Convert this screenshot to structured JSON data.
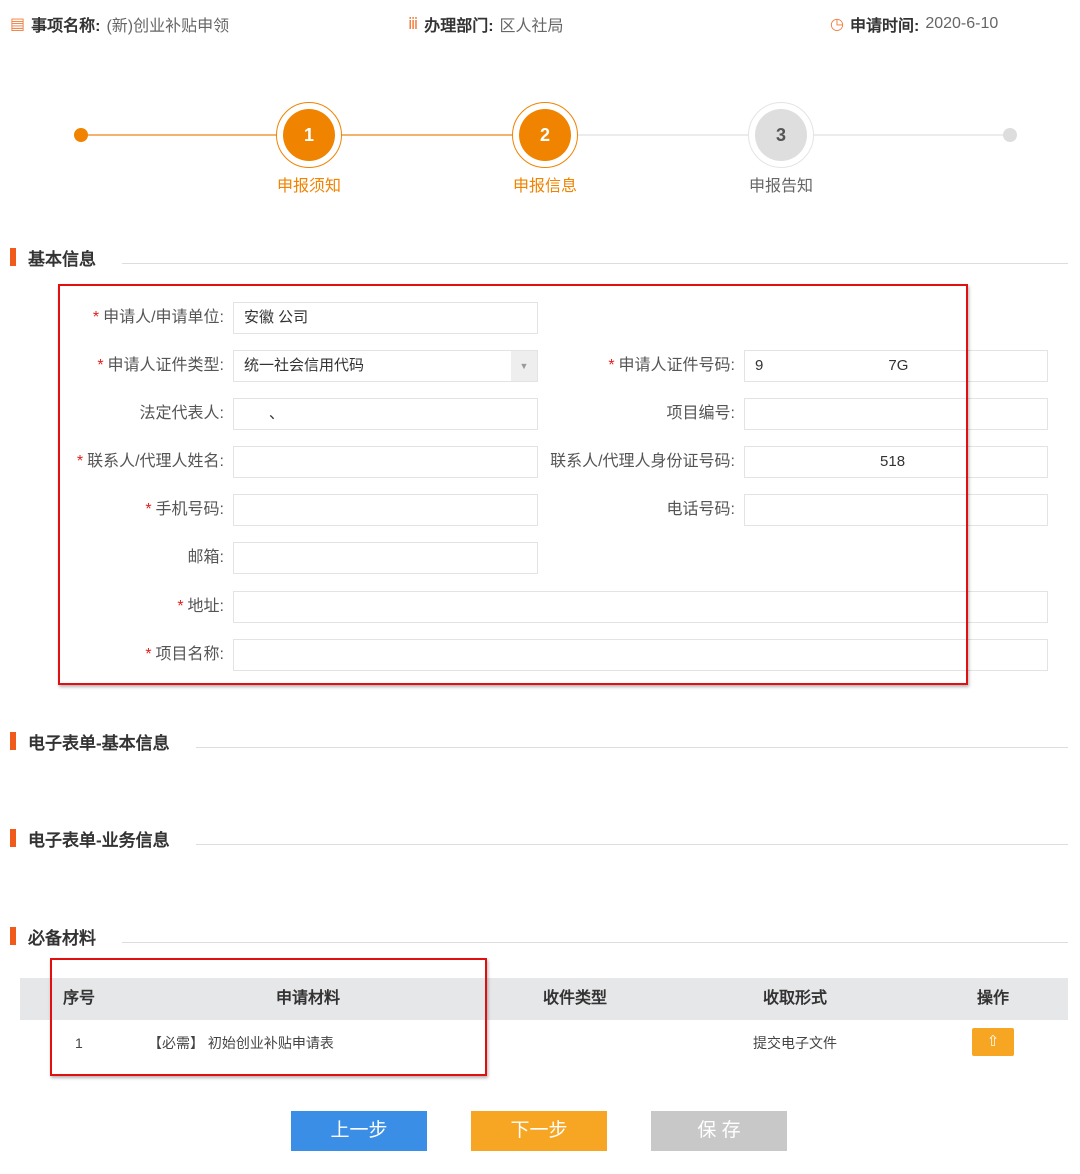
{
  "header": {
    "item_label": "事项名称:",
    "item_value": "(新)创业补贴申领",
    "dept_label": "办理部门:",
    "dept_value": "区人社局",
    "time_label": "申请时间:",
    "time_value": "2020-6-10"
  },
  "steps": [
    {
      "num": "1",
      "label": "申报须知",
      "state": "done"
    },
    {
      "num": "2",
      "label": "申报信息",
      "state": "active"
    },
    {
      "num": "3",
      "label": "申报告知",
      "state": "pending"
    }
  ],
  "sections": {
    "basic": "基本信息",
    "eform_basic": "电子表单-基本信息",
    "eform_business": "电子表单-业务信息",
    "materials": "必备材料"
  },
  "form": {
    "applicant": {
      "label": "申请人/申请单位:",
      "value": "安徽                              公司",
      "required": true
    },
    "id_type": {
      "label": "申请人证件类型:",
      "value": "统一社会信用代码",
      "required": true
    },
    "id_number": {
      "label": "申请人证件号码:",
      "value": "9                              7G",
      "required": true
    },
    "legal_rep": {
      "label": "法定代表人:",
      "value": "      、"
    },
    "project_no": {
      "label": "项目编号:",
      "value": ""
    },
    "contact_name": {
      "label": "联系人/代理人姓名:",
      "value": "",
      "required": true
    },
    "contact_id": {
      "label": "联系人/代理人身份证号码:",
      "value": "                              518"
    },
    "mobile": {
      "label": "手机号码:",
      "value": "",
      "required": true
    },
    "phone": {
      "label": "电话号码:",
      "value": ""
    },
    "email": {
      "label": "邮箱:",
      "value": ""
    },
    "address": {
      "label": "地址:",
      "value": "",
      "required": true
    },
    "project_name": {
      "label": "项目名称:",
      "value": "",
      "required": true
    }
  },
  "table": {
    "headers": [
      "序号",
      "申请材料",
      "收件类型",
      "收取形式",
      "操作"
    ],
    "rows": [
      {
        "no": "1",
        "material": "【必需】 初始创业补贴申请表",
        "type": "",
        "form": "提交电子文件"
      }
    ]
  },
  "buttons": {
    "prev": "上一步",
    "next": "下一步",
    "save": "保 存"
  },
  "colors": {
    "accent": "#f08300",
    "blue": "#3a8ee6",
    "yellow": "#f7a623",
    "gray": "#c8c8c8"
  }
}
